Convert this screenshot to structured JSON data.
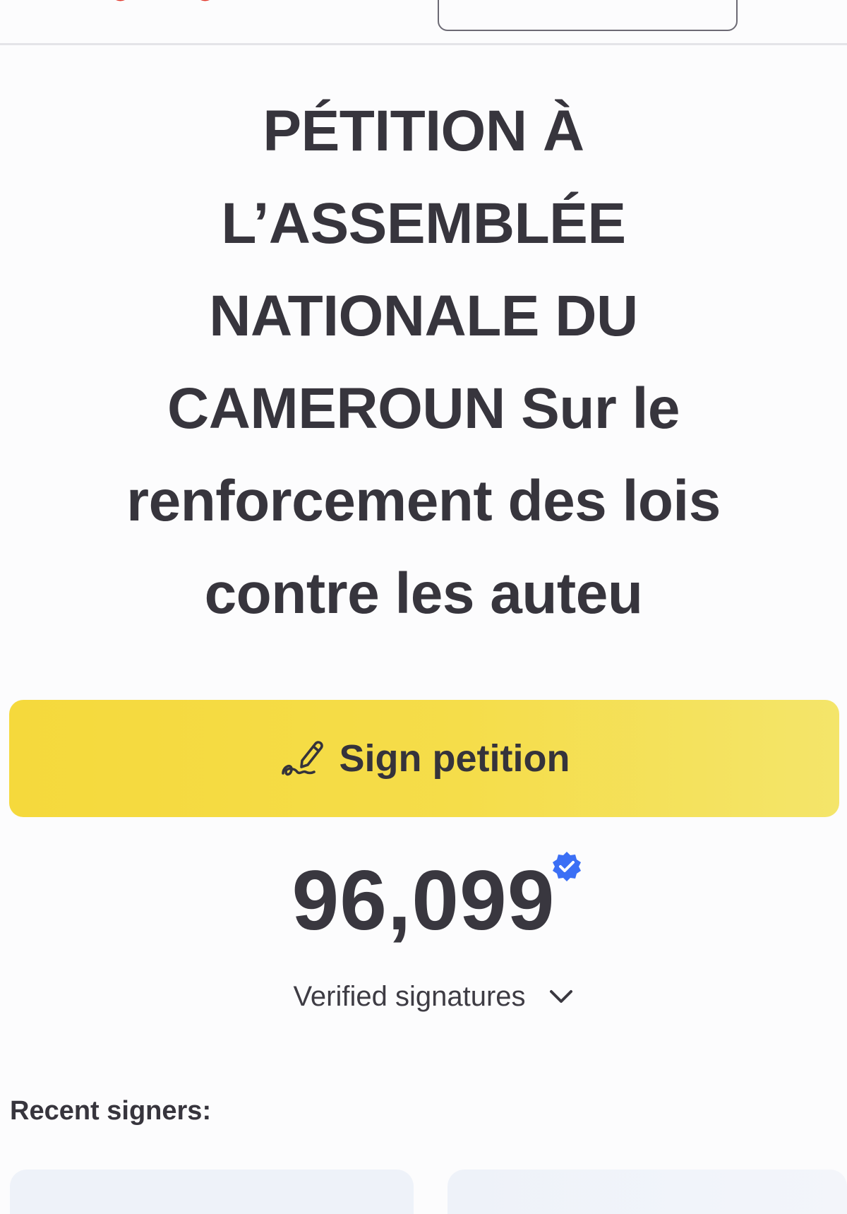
{
  "header": {
    "brand_icon": "brand-logo-partial",
    "top_button_label": ""
  },
  "petition": {
    "title_lines": [
      "PÉTITION À",
      "L’ASSEMBLÉE",
      "NATIONALE DU",
      "CAMEROUN Sur le",
      "renforcement des lois",
      "contre les auteu"
    ]
  },
  "sign_button": {
    "label": "Sign petition",
    "icon": "signature-pen-icon",
    "color": "#f5d93c"
  },
  "signatures": {
    "count": "96,099",
    "verified_icon": "verified-badge-icon",
    "verified_color": "#3b6ff5",
    "label": "Verified signatures",
    "toggle_icon": "chevron-down-icon"
  },
  "recent": {
    "heading": "Recent signers:",
    "signers": [
      {
        "text": ""
      },
      {
        "text": ""
      }
    ]
  }
}
